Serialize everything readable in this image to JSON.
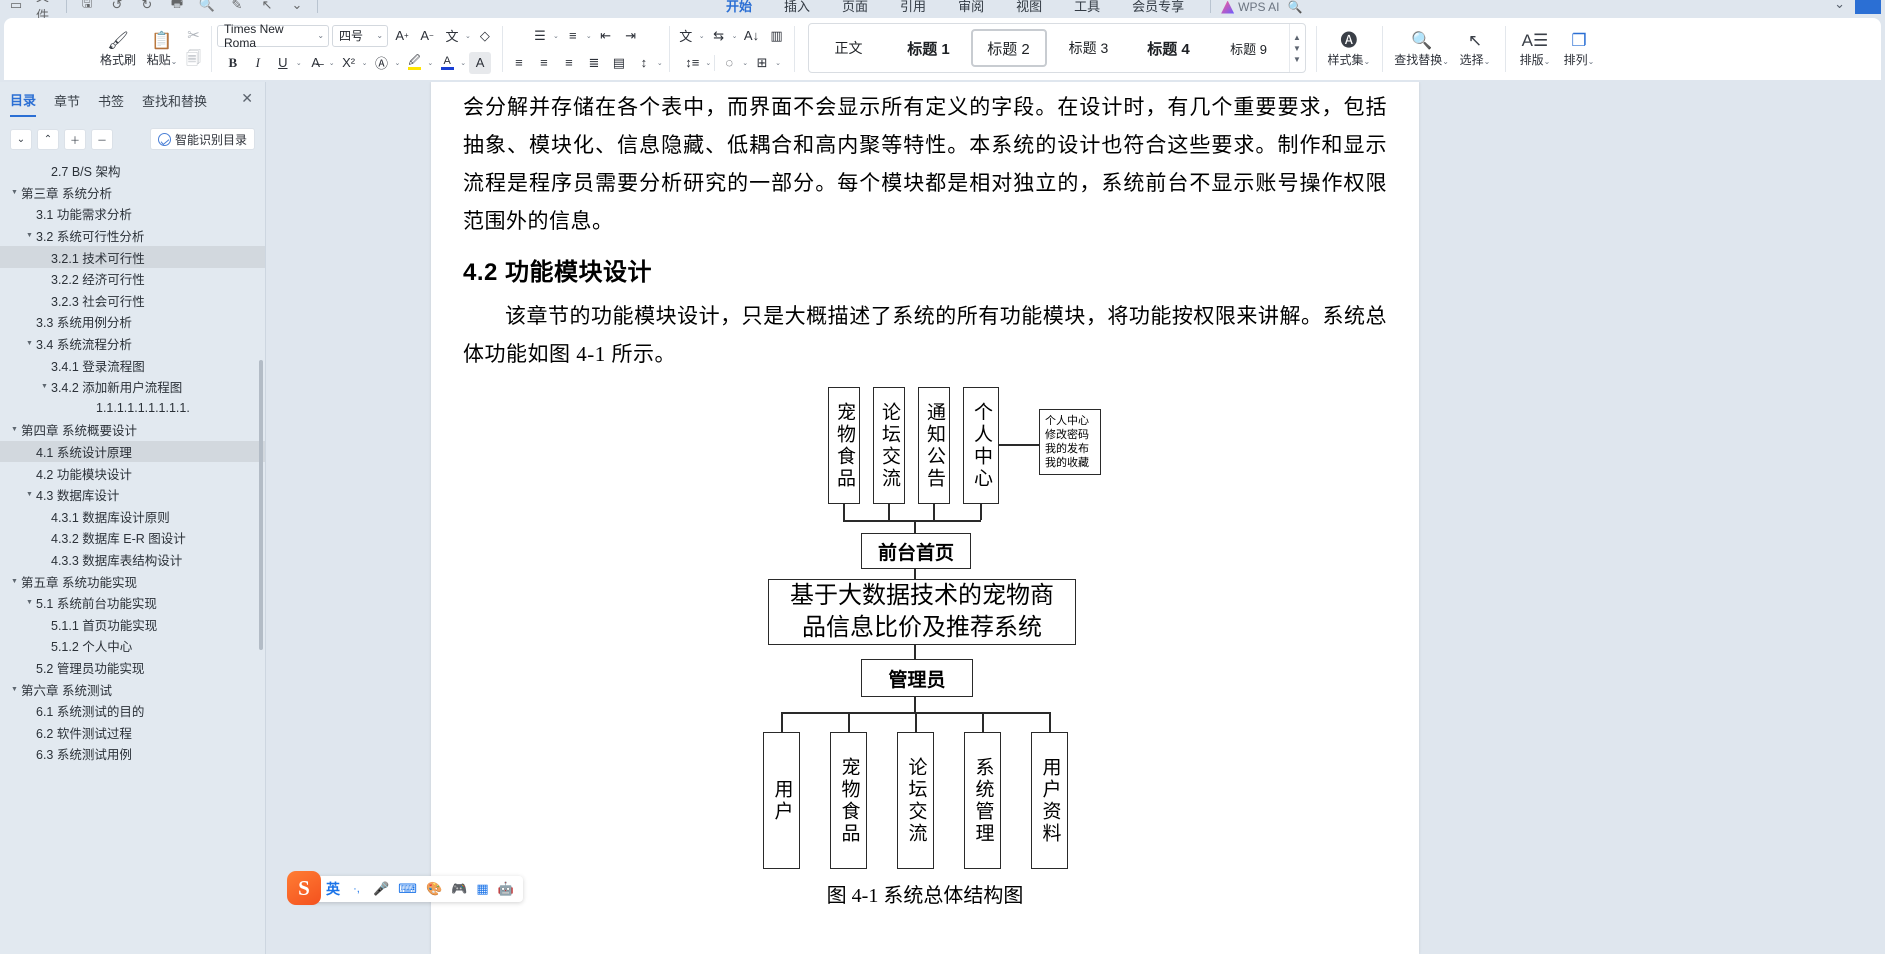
{
  "window": {
    "quick_access": [
      "save-icon",
      "undo-icon",
      "redo-icon",
      "print-icon",
      "print-preview-icon",
      "touch-icon",
      "cursor-icon",
      "more-icon"
    ],
    "file_menu_label": "文件"
  },
  "ribbon": {
    "tabs": [
      {
        "label": "开始",
        "active": true
      },
      {
        "label": "插入",
        "active": false
      },
      {
        "label": "页面",
        "active": false
      },
      {
        "label": "引用",
        "active": false
      },
      {
        "label": "审阅",
        "active": false
      },
      {
        "label": "视图",
        "active": false
      },
      {
        "label": "工具",
        "active": false
      },
      {
        "label": "会员专享",
        "active": false
      }
    ],
    "ai_label": "WPS AI",
    "search_icon": "search-icon",
    "clipboard": {
      "format_painter": "格式刷",
      "paste": "粘贴",
      "cut_icon": "scissors-icon",
      "copy_icon": "copy-icon"
    },
    "font": {
      "family_value": "Times New Roma",
      "size_value": "四号",
      "grow_label": "A+",
      "shrink_label": "A-",
      "pinyin_label": "拼音指南",
      "clear_format_label": "清除格式",
      "bold": "B",
      "italic": "I",
      "underline": "U",
      "strikethrough": "删除线",
      "superscript": "X²",
      "char_border": "字符边框",
      "highlight": "突出显示",
      "font_color": "字体颜色",
      "char_shading": "字符底纹"
    },
    "paragraph": {
      "bullets": "项目符号",
      "numbering": "编号",
      "multilevel": "多级列表",
      "decrease_indent": "减少缩进",
      "increase_indent": "增加缩进",
      "align_left": "左对齐",
      "align_center": "居中",
      "align_right": "右对齐",
      "justify": "两端对齐",
      "distribute": "分散对齐",
      "line_spacing": "行距",
      "pinyin2": "拼音",
      "sort": "排序",
      "show_marks": "显示段落标记",
      "shading": "底纹",
      "borders": "边框"
    },
    "styles_gallery": [
      {
        "label": "正文",
        "cls": "",
        "active": false
      },
      {
        "label": "标题 1",
        "cls": "h1",
        "active": false
      },
      {
        "label": "标题 2",
        "cls": "h2",
        "active": true
      },
      {
        "label": "标题 3",
        "cls": "h3",
        "active": false
      },
      {
        "label": "标题 4",
        "cls": "h4",
        "active": false
      },
      {
        "label": "标题 9",
        "cls": "h9",
        "active": false
      }
    ],
    "right_buttons": [
      {
        "label": "样式集",
        "icon": "style-set-icon",
        "caret": true
      },
      {
        "label": "查找替换",
        "icon": "search-icon",
        "caret": true
      },
      {
        "label": "选择",
        "icon": "pointer-icon",
        "caret": true
      },
      {
        "label": "排版",
        "icon": "typeset-icon",
        "caret": true
      },
      {
        "label": "排列",
        "icon": "arrange-icon",
        "caret": true
      }
    ]
  },
  "sidebar": {
    "tabs": [
      {
        "label": "目录",
        "active": true
      },
      {
        "label": "章节",
        "active": false
      },
      {
        "label": "书签",
        "active": false
      },
      {
        "label": "查找和替换",
        "active": false
      }
    ],
    "close_icon": "close-icon",
    "tools": [
      {
        "icon": "chevron-down-icon",
        "glyph": "⌄"
      },
      {
        "icon": "chevron-up-icon",
        "glyph": "⌃"
      },
      {
        "icon": "plus-icon",
        "glyph": "+"
      },
      {
        "icon": "minus-icon",
        "glyph": "−"
      }
    ],
    "smart_toc_label": "智能识别目录",
    "toc_items": [
      {
        "label": "2.7 B/S 架构",
        "indent": 2,
        "caret": false,
        "selected": false
      },
      {
        "label": "第三章 系统分析",
        "indent": 0,
        "caret": true,
        "selected": false
      },
      {
        "label": "3.1 功能需求分析",
        "indent": 1,
        "caret": false,
        "selected": false
      },
      {
        "label": "3.2 系统可行性分析",
        "indent": 1,
        "caret": true,
        "selected": false
      },
      {
        "label": "3.2.1 技术可行性",
        "indent": 2,
        "caret": false,
        "selected": true
      },
      {
        "label": "3.2.2 经济可行性",
        "indent": 2,
        "caret": false,
        "selected": false
      },
      {
        "label": "3.2.3 社会可行性",
        "indent": 2,
        "caret": false,
        "selected": false
      },
      {
        "label": "3.3 系统用例分析",
        "indent": 1,
        "caret": false,
        "selected": false
      },
      {
        "label": "3.4 系统流程分析",
        "indent": 1,
        "caret": true,
        "selected": false
      },
      {
        "label": "3.4.1 登录流程图",
        "indent": 2,
        "caret": false,
        "selected": false
      },
      {
        "label": "3.4.2 添加新用户流程图",
        "indent": 2,
        "caret": true,
        "selected": false
      },
      {
        "label": "1.1.1.1.1.1.1.1.1.",
        "indent": 5,
        "caret": false,
        "selected": false
      },
      {
        "label": "第四章 系统概要设计",
        "indent": 0,
        "caret": true,
        "selected": false
      },
      {
        "label": "4.1 系统设计原理",
        "indent": 1,
        "caret": false,
        "selected": true
      },
      {
        "label": "4.2 功能模块设计",
        "indent": 1,
        "caret": false,
        "selected": false
      },
      {
        "label": "4.3 数据库设计",
        "indent": 1,
        "caret": true,
        "selected": false
      },
      {
        "label": "4.3.1 数据库设计原则",
        "indent": 2,
        "caret": false,
        "selected": false
      },
      {
        "label": "4.3.2 数据库 E-R 图设计",
        "indent": 2,
        "caret": false,
        "selected": false
      },
      {
        "label": "4.3.3 数据库表结构设计",
        "indent": 2,
        "caret": false,
        "selected": false
      },
      {
        "label": "第五章 系统功能实现",
        "indent": 0,
        "caret": true,
        "selected": false
      },
      {
        "label": "5.1 系统前台功能实现",
        "indent": 1,
        "caret": true,
        "selected": false
      },
      {
        "label": "5.1.1 首页功能实现",
        "indent": 2,
        "caret": false,
        "selected": false
      },
      {
        "label": "5.1.2 个人中心",
        "indent": 2,
        "caret": false,
        "selected": false
      },
      {
        "label": "5.2 管理员功能实现",
        "indent": 1,
        "caret": false,
        "selected": false
      },
      {
        "label": "第六章 系统测试",
        "indent": 0,
        "caret": true,
        "selected": false
      },
      {
        "label": "6.1 系统测试的目的",
        "indent": 1,
        "caret": false,
        "selected": false
      },
      {
        "label": "6.2 软件测试过程",
        "indent": 1,
        "caret": false,
        "selected": false
      },
      {
        "label": "6.3 系统测试用例",
        "indent": 1,
        "caret": false,
        "selected": false
      }
    ]
  },
  "document": {
    "paragraph_1": "会分解并存储在各个表中，而界面不会显示所有定义的字段。在设计时，有几个重要要求，包括抽象、模块化、信息隐藏、低耦合和高内聚等特性。本系统的设计也符合这些要求。制作和显示流程是程序员需要分析研究的一部分。每个模块都是相对独立的，系统前台不显示账号操作权限范围外的信息。",
    "heading_4_2": "4.2 功能模块设计",
    "paragraph_2": "该章节的功能模块设计，只是大概描述了系统的所有功能模块，将功能按权限来讲解。系统总体功能如图 4-1 所示。",
    "figure_caption": "图 4-1 系统总体结构图"
  },
  "diagram": {
    "front_top_boxes": [
      "宠物食品",
      "论坛交流",
      "通知公告",
      "个人中心"
    ],
    "callout_lines": [
      "个人中心",
      "修改密码",
      "我的发布",
      "我的收藏"
    ],
    "front_home": "前台首页",
    "system_title": "基于大数据技术的宠物商品信息比价及推荐系统",
    "admin": "管理员",
    "admin_boxes": [
      "用户",
      "宠物食品",
      "论坛交流",
      "系统管理",
      "用户资料"
    ]
  },
  "ime": {
    "engine_logo": "S",
    "mode_label": "英",
    "items": [
      {
        "icon": "comma-dot-icon",
        "glyph": "·,"
      },
      {
        "icon": "microphone-icon",
        "glyph": "🎤"
      },
      {
        "icon": "keyboard-icon",
        "glyph": "⌨"
      },
      {
        "icon": "skin-icon",
        "glyph": "♣"
      },
      {
        "icon": "game-icon",
        "glyph": "🎮"
      },
      {
        "icon": "apps-icon",
        "glyph": "■"
      },
      {
        "icon": "robot-icon",
        "glyph": "🤖"
      }
    ]
  },
  "colors": {
    "accent": "#2b6fd4",
    "chrome_bg": "#dfe6ee",
    "sidebar_bg": "#e2e9f0",
    "selected_row": "#d2d8de",
    "page_bg": "#ffffff",
    "diagram_stroke": "#2a2a2a"
  }
}
